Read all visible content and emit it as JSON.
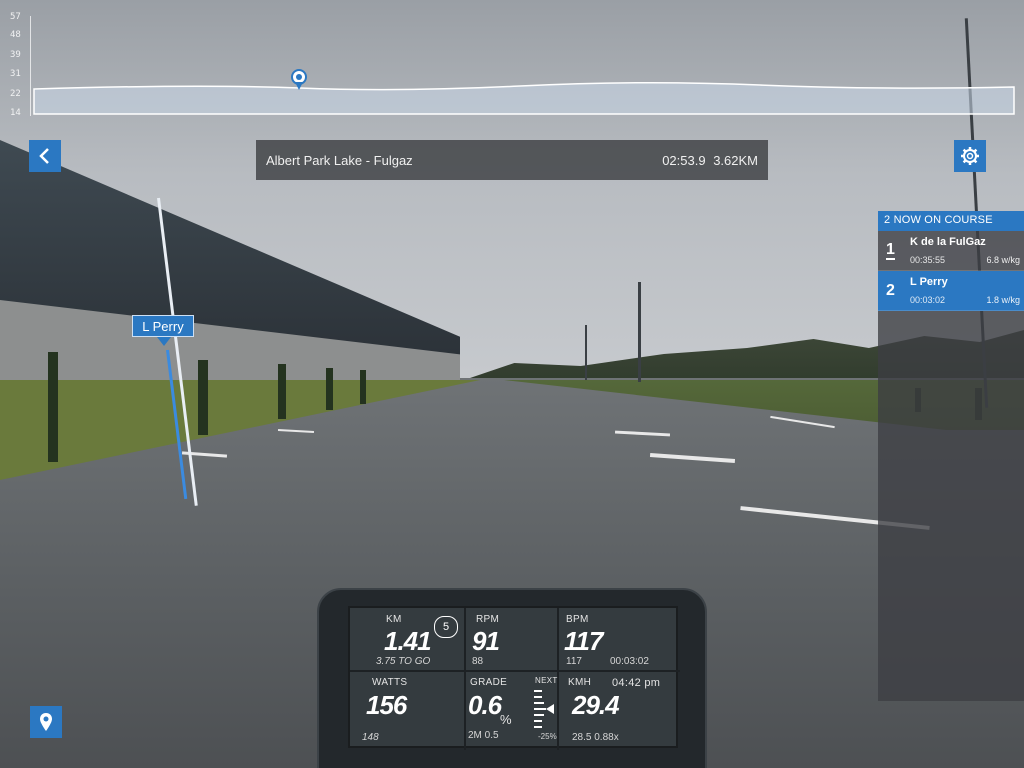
{
  "elevation": {
    "ticks": [
      "57",
      "48",
      "39",
      "31",
      "22",
      "14"
    ]
  },
  "header": {
    "course": "Albert Park Lake - Fulgaz",
    "elapsed": "02:53.9",
    "distance": "3.62KM"
  },
  "rider_marker": {
    "name": "L Perry"
  },
  "leaderboard": {
    "title": "2 NOW ON COURSE",
    "riders": [
      {
        "position": "1",
        "name": "K de la FulGaz",
        "time": "00:35:55",
        "wkg": "6.8 w/kg"
      },
      {
        "position": "2",
        "name": "L Perry",
        "time": "00:03:02",
        "wkg": "1.8 w/kg"
      }
    ]
  },
  "computer": {
    "km_label": "KM",
    "km_value": "1.41",
    "km_sub": "3.75 TO GO",
    "lap": "5",
    "rpm_label": "RPM",
    "rpm_value": "91",
    "rpm_sub": "88",
    "bpm_label": "BPM",
    "bpm_value": "117",
    "bpm_sub": "117",
    "bpm_time": "00:03:02",
    "watts_label": "WATTS",
    "watts_value": "156",
    "watts_sub": "148",
    "grade_label": "GRADE",
    "grade_value": "0.6",
    "grade_unit": "%",
    "grade_sub": "2M 0.5",
    "next_label": "NEXT",
    "next_value": "-25%",
    "kmh_label": "KMH",
    "clock": "04:42 pm",
    "kmh_value": "29.4",
    "kmh_sub": "28.5 0.88x"
  },
  "colors": {
    "accent": "#2b78c2"
  },
  "icons": {
    "back": "chevron-left-icon",
    "settings": "gear-icon",
    "map": "map-pin-icon",
    "profile_marker": "location-marker-icon"
  }
}
